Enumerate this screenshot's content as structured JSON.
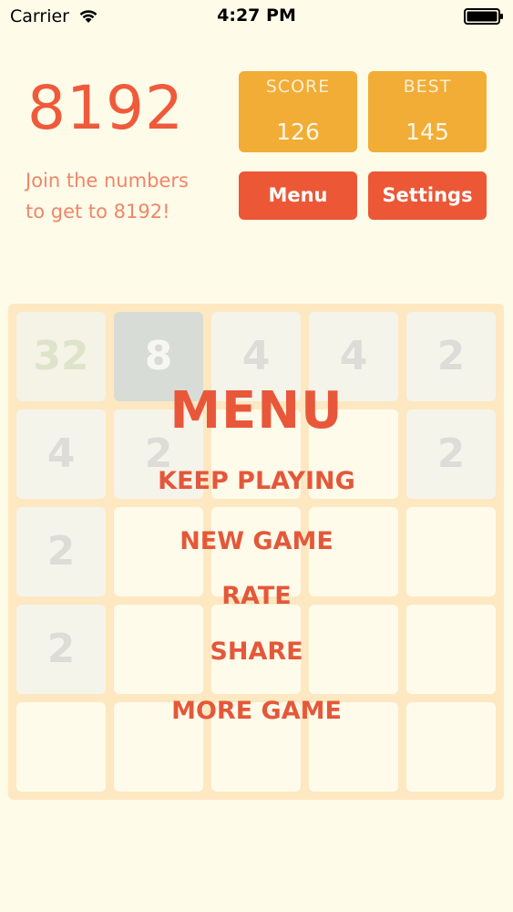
{
  "status_bar": {
    "carrier": "Carrier",
    "time": "4:27 PM"
  },
  "header": {
    "logo": "8192",
    "tagline_line1": "Join the numbers",
    "tagline_line2": "to get to 8192!",
    "score_label": "SCORE",
    "score_value": "126",
    "best_label": "BEST",
    "best_value": "145",
    "menu_button": "Menu",
    "settings_button": "Settings"
  },
  "board": {
    "size": 5,
    "rows": [
      [
        "32",
        "8",
        "4",
        "4",
        "2"
      ],
      [
        "4",
        "2",
        "",
        "",
        "2"
      ],
      [
        "2",
        "",
        "",
        "",
        ""
      ],
      [
        "2",
        "",
        "",
        "",
        ""
      ],
      [
        "",
        "",
        "",
        "",
        ""
      ]
    ]
  },
  "menu": {
    "title": "MENU",
    "items": [
      "KEEP PLAYING",
      "NEW GAME",
      "RATE",
      "SHARE",
      "MORE GAME"
    ]
  },
  "colors": {
    "background": "#fffbe9",
    "accent": "#ec5736",
    "score_box": "#f1ad36",
    "board": "#fde8c2"
  },
  "icons": {
    "wifi": "wifi-icon",
    "battery": "battery-icon"
  }
}
